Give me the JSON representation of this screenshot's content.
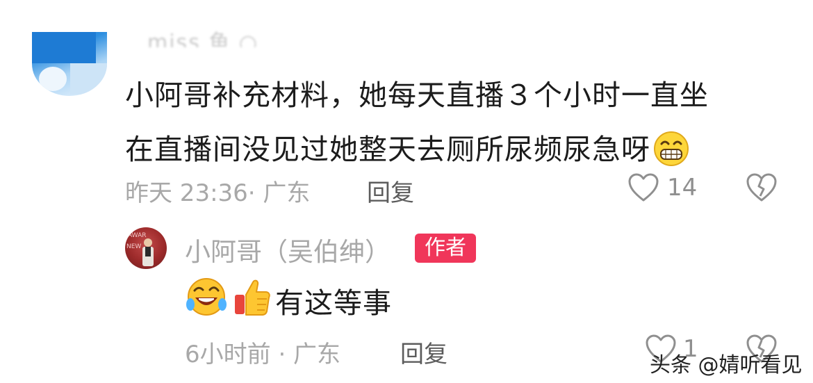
{
  "comment": {
    "text_line1": "小阿哥补充材料，她每天直播３个小时一直坐",
    "text_line2": "在直播间没见过她整天去厕所尿频尿急呀",
    "meta": "昨天 23:36· 广东",
    "reply_label": "回复",
    "like_count": "14",
    "icons": [
      "grin-emoji",
      "heart-icon",
      "broken-heart-icon"
    ]
  },
  "author_reply": {
    "name": "小阿哥（吴伯绅）",
    "badge": "作者",
    "text": "有这等事",
    "meta": "6小时前 · 广东",
    "reply_label": "回复",
    "like_count": "1",
    "icons": [
      "rolling-laughing-emoji",
      "thumbs-up-emoji",
      "heart-icon",
      "broken-heart-icon"
    ]
  },
  "watermark": "头条 @婧听看见",
  "colors": {
    "badge": "#f0365a",
    "muted": "#a8a8a8",
    "text": "#1c1c1c"
  }
}
